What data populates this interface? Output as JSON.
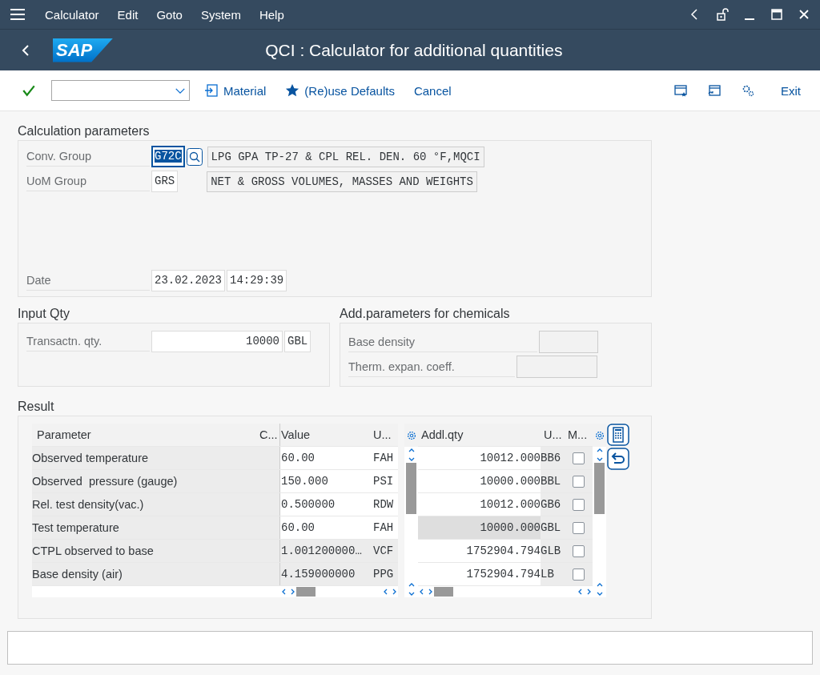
{
  "menu": [
    {
      "label": "Calculator"
    },
    {
      "label": "Edit"
    },
    {
      "label": "Goto"
    },
    {
      "label": "System"
    },
    {
      "label": "Help"
    }
  ],
  "header": {
    "logo": "SAP",
    "title": "QCI : Calculator for additional quantities"
  },
  "toolbar": {
    "buttons": [
      {
        "label": "Material",
        "kind": "import"
      },
      {
        "label": "(Re)use Defaults",
        "kind": "star"
      },
      {
        "label": "Cancel",
        "kind": "plain"
      }
    ],
    "exit": "Exit"
  },
  "calc_params": {
    "title": "Calculation parameters",
    "conv_group": {
      "label": "Conv. Group",
      "value": "G72C",
      "description": "LPG GPA TP-27 & CPL REL. DEN. 60 °F,MQCI"
    },
    "uom_group": {
      "label": "UoM Group",
      "value": "GRS",
      "description": "NET & GROSS VOLUMES, MASSES AND WEIGHTS"
    },
    "date": {
      "label": "Date",
      "date": "23.02.2023",
      "time": "14:29:39"
    }
  },
  "input_qty": {
    "title": "Input Qty",
    "label": "Transactn. qty.",
    "value": "10000",
    "unit": "GBL"
  },
  "chem_params": {
    "title": "Add.parameters for chemicals",
    "fields": [
      {
        "label": "Base density"
      },
      {
        "label": "Therm. expan. coeff."
      }
    ]
  },
  "result": {
    "title": "Result",
    "left_columns": [
      "Parameter",
      "C...",
      "Value",
      "U..."
    ],
    "left_rows": [
      {
        "parameter": "Observed temperature",
        "value": "60.00",
        "unit": "FAH",
        "editable": true
      },
      {
        "parameter": "Observed  pressure (gauge)",
        "value": "150.000",
        "unit": "PSI",
        "editable": true
      },
      {
        "parameter": "Rel. test density(vac.)",
        "value": "0.500000",
        "unit": "RDW",
        "editable": true
      },
      {
        "parameter": "Test temperature",
        "value": "60.00",
        "unit": "FAH",
        "editable": true
      },
      {
        "parameter": "CTPL observed to base",
        "value": "1.001200000…",
        "unit": "VCF",
        "editable": false
      },
      {
        "parameter": "Base density (air)",
        "value": "4.159000000",
        "unit": "PPG",
        "editable": false
      }
    ],
    "right_columns": [
      "Addl.qty",
      "U...",
      "M..."
    ],
    "right_rows": [
      {
        "qty": "10012.000",
        "unit": "BB6",
        "checked": false,
        "selected": false
      },
      {
        "qty": "10000.000",
        "unit": "BBL",
        "checked": false,
        "selected": false
      },
      {
        "qty": "10012.000",
        "unit": "GB6",
        "checked": false,
        "selected": false
      },
      {
        "qty": "10000.000",
        "unit": "GBL",
        "checked": false,
        "selected": true
      },
      {
        "qty": "1752904.794",
        "unit": "GLB",
        "checked": false,
        "selected": false
      },
      {
        "qty": "1752904.794",
        "unit": "LB",
        "checked": false,
        "selected": false
      }
    ]
  }
}
